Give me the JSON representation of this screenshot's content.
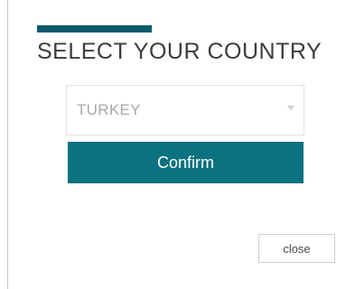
{
  "dialog": {
    "title": "SELECT YOUR COUNTRY",
    "country_select": {
      "selected": "TURKEY"
    },
    "confirm_label": "Confirm",
    "close_label": "close"
  },
  "colors": {
    "accent_bar": "#0b5a6b",
    "confirm_button": "#0b7280",
    "confirm_text": "#ffffff",
    "title_text": "#3c3c3c",
    "select_text": "#a8a8a8"
  },
  "icons": {
    "select_caret": "chevron-down-icon"
  }
}
